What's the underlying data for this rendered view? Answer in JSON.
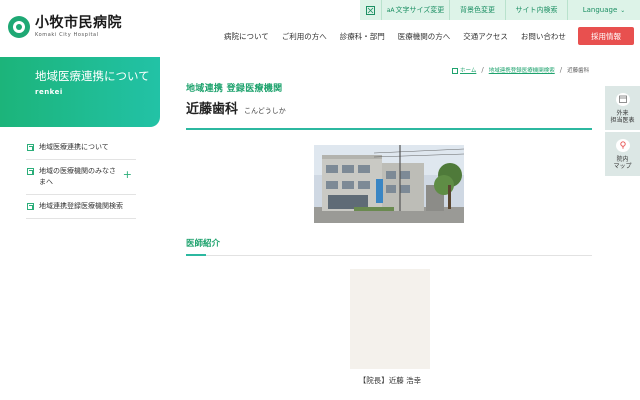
{
  "utility": {
    "text_size": "文字サイズ変更",
    "text_size_glyph": "aA",
    "bg_color": "背景色変更",
    "site_search": "サイト内検索",
    "language": "Language"
  },
  "header": {
    "logo_ja": "小牧市民病院",
    "logo_en": "Komaki City Hospital",
    "nav": [
      "病院について",
      "ご利用の方へ",
      "診療科・部門",
      "医療機関の方へ",
      "交通アクセス",
      "お問い合わせ"
    ],
    "recruit": "採用情報"
  },
  "sidebar": {
    "hero_title": "地域医療連携について",
    "hero_sub": "renkei",
    "items": [
      {
        "label": "地域医療連携について"
      },
      {
        "label": "地域の医療機関のみなさまへ",
        "plus": "+"
      },
      {
        "label": "地域連携登録医療機関検索"
      }
    ]
  },
  "breadcrumb": {
    "home": "ホーム",
    "sep": "/",
    "link": "地域連携登録医療機関検索",
    "current": "近藤歯科"
  },
  "main": {
    "category": "地域連携 登録医療機関",
    "title": "近藤歯科",
    "title_kana": "こんどうしか",
    "section_title": "医師紹介",
    "doctor_caption": "【院長】近藤 浩幸"
  },
  "float_tabs": [
    {
      "label": "外来\n担当医表",
      "icon": "calendar-icon"
    },
    {
      "label": "院内\nマップ",
      "icon": "map-pin-icon"
    }
  ],
  "colors": {
    "brand_green": "#1fa36e",
    "accent_teal": "#2cb8a0",
    "recruit_red": "#e8504f",
    "util_bg": "#ddf3e8"
  }
}
